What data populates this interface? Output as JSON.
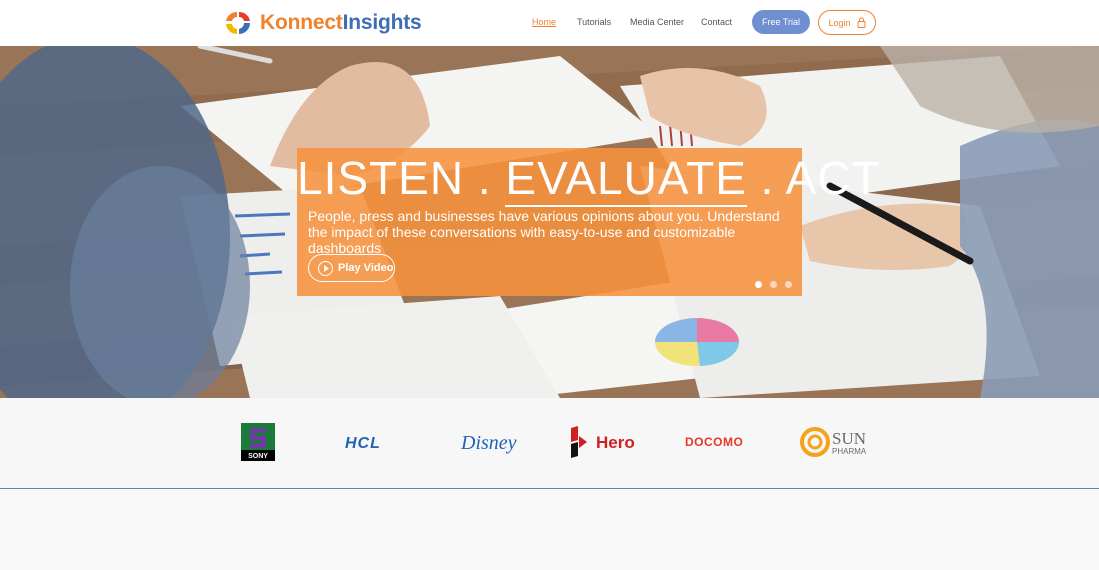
{
  "brand": {
    "name_part1": "Konnect",
    "name_part2": "Insights"
  },
  "nav": {
    "items": [
      {
        "label": "Home",
        "active": true
      },
      {
        "label": "Tutorials",
        "active": false
      },
      {
        "label": "Media Center",
        "active": false
      },
      {
        "label": "Contact",
        "active": false
      }
    ],
    "free_trial": "Free Trial",
    "login": "Login"
  },
  "hero": {
    "title_1": "LISTEN . ",
    "title_2": "EVALUATE",
    "title_3": " . ACT",
    "subtitle": "People, press and businesses have various opinions about you. Understand the impact of these conversations with easy-to-use and customizable dashboards",
    "play_label": "Play Video",
    "slides": 3,
    "active_slide": 1
  },
  "clients": {
    "sony": "SONY",
    "hcl": "HCL",
    "disney": "Disney",
    "hero": "Hero",
    "docomo": "DOCOMO",
    "sun_1": "SUN",
    "sun_2": "PHARMA"
  },
  "colors": {
    "accent": "#f0822d",
    "brand_blue": "#3d6eb5",
    "trial_blue": "#6e8fd0",
    "overlay": "#f6923e"
  }
}
